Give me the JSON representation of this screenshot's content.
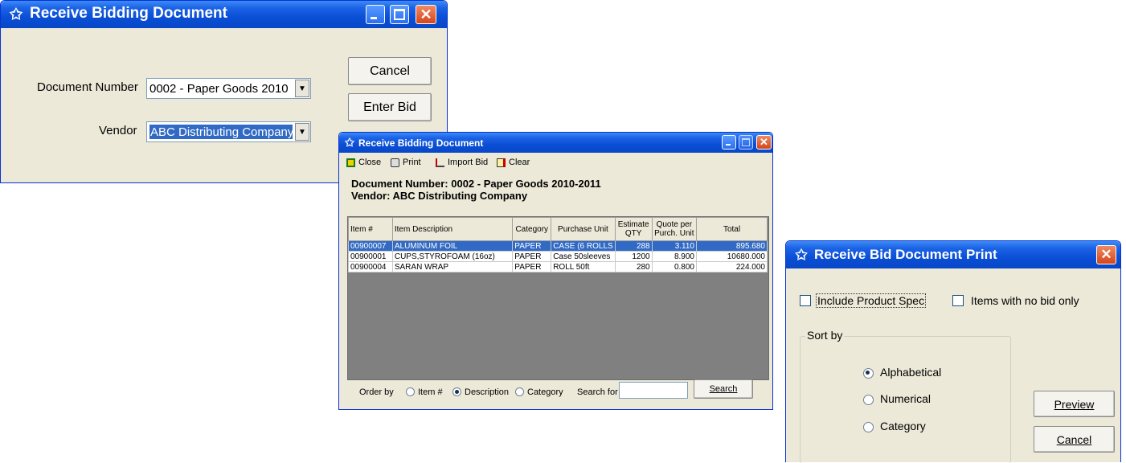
{
  "win1": {
    "title": "Receive Bidding Document",
    "doc_label": "Document Number",
    "doc_value": "0002 - Paper Goods 2010",
    "vendor_label": "Vendor",
    "vendor_value": "ABC Distributing Company",
    "cancel": "Cancel",
    "enter_bid": "Enter Bid"
  },
  "win2": {
    "title": "Receive Bidding Document",
    "toolbar": {
      "close": "Close",
      "print": "Print",
      "import": "Import Bid",
      "clear": "Clear"
    },
    "doc_line": "Document Number: 0002 - Paper Goods 2010-2011",
    "vendor_line": "Vendor: ABC Distributing Company",
    "columns": {
      "item": "Item #",
      "desc": "Item Description",
      "cat": "Category",
      "pu": "Purchase Unit",
      "qty_1": "Estimate",
      "qty_2": "QTY",
      "quote_1": "Quote per",
      "quote_2": "Purch. Unit",
      "total": "Total"
    },
    "rows": [
      {
        "item": "00900007",
        "desc": "ALUMINUM FOIL",
        "cat": "PAPER",
        "pu": "CASE (6 ROLLS",
        "qty": "288",
        "quote": "3.110",
        "total": "895.680"
      },
      {
        "item": "00900001",
        "desc": "CUPS,STYROFOAM (16oz)",
        "cat": "PAPER",
        "pu": "Case 50sleeves",
        "qty": "1200",
        "quote": "8.900",
        "total": "10680.000"
      },
      {
        "item": "00900004",
        "desc": "SARAN WRAP",
        "cat": "PAPER",
        "pu": "ROLL 50ft",
        "qty": "280",
        "quote": "0.800",
        "total": "224.000"
      }
    ],
    "order_by": "Order by",
    "opt_item": "Item #",
    "opt_desc": "Description",
    "opt_cat": "Category",
    "search_for": "Search for",
    "search_value": "",
    "search_btn": "Search"
  },
  "win3": {
    "title": "Receive Bid Document Print",
    "include_spec": "Include Product Spec",
    "no_bid_only": "Items with no bid only",
    "sort_by": "Sort by",
    "alphabetical": "Alphabetical",
    "numerical": "Numerical",
    "category": "Category",
    "preview": "Preview",
    "cancel": "Cancel"
  }
}
